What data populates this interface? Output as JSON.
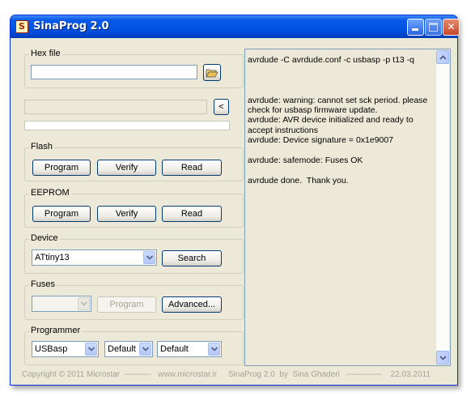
{
  "window": {
    "title": "SinaProg 2.0",
    "icon_letter": "S",
    "controls": [
      "minimize-icon",
      "maximize-icon",
      "close-icon"
    ],
    "close_glyph": "✕"
  },
  "hex_file": {
    "label": "Hex file",
    "path_value": "",
    "browse_icon": "folder-open-icon"
  },
  "status": {
    "field_value": "",
    "toggle_log_label": "<",
    "progress": 0
  },
  "flash": {
    "label": "Flash",
    "program_label": "Program",
    "verify_label": "Verify",
    "read_label": "Read"
  },
  "eeprom": {
    "label": "EEPROM",
    "program_label": "Program",
    "verify_label": "Verify",
    "read_label": "Read"
  },
  "device": {
    "label": "Device",
    "selected": "ATtiny13",
    "search_label": "Search"
  },
  "fuses": {
    "label": "Fuses",
    "selected": "",
    "program_label": "Program",
    "advanced_label": "Advanced..."
  },
  "programmer": {
    "label": "Programmer",
    "type_selected": "USBasp",
    "port_selected": "Default",
    "speed_selected": "Default"
  },
  "log": {
    "text": "avrdude -C avrdude.conf -c usbasp -p t13 -q\n\n\n\navrdude: warning: cannot set sck period. please check for usbasp firmware update.\navrdude: AVR device initialized and ready to accept instructions\navrdude: Device signature = 0x1e9007\n\navrdude: safemode: Fuses OK\n\navrdude done.  Thank you."
  },
  "footer": {
    "text": "Copyright © 2011 Microstar  ----------   www.microstar.ir     SinaProg 2.0  by  Sina Ghaderi   -------------    22.03.2011"
  },
  "colors": {
    "titlebar": "#0053e3",
    "window_face": "#ece9d8",
    "field_border": "#7f9db9",
    "button_border": "#003c74"
  }
}
